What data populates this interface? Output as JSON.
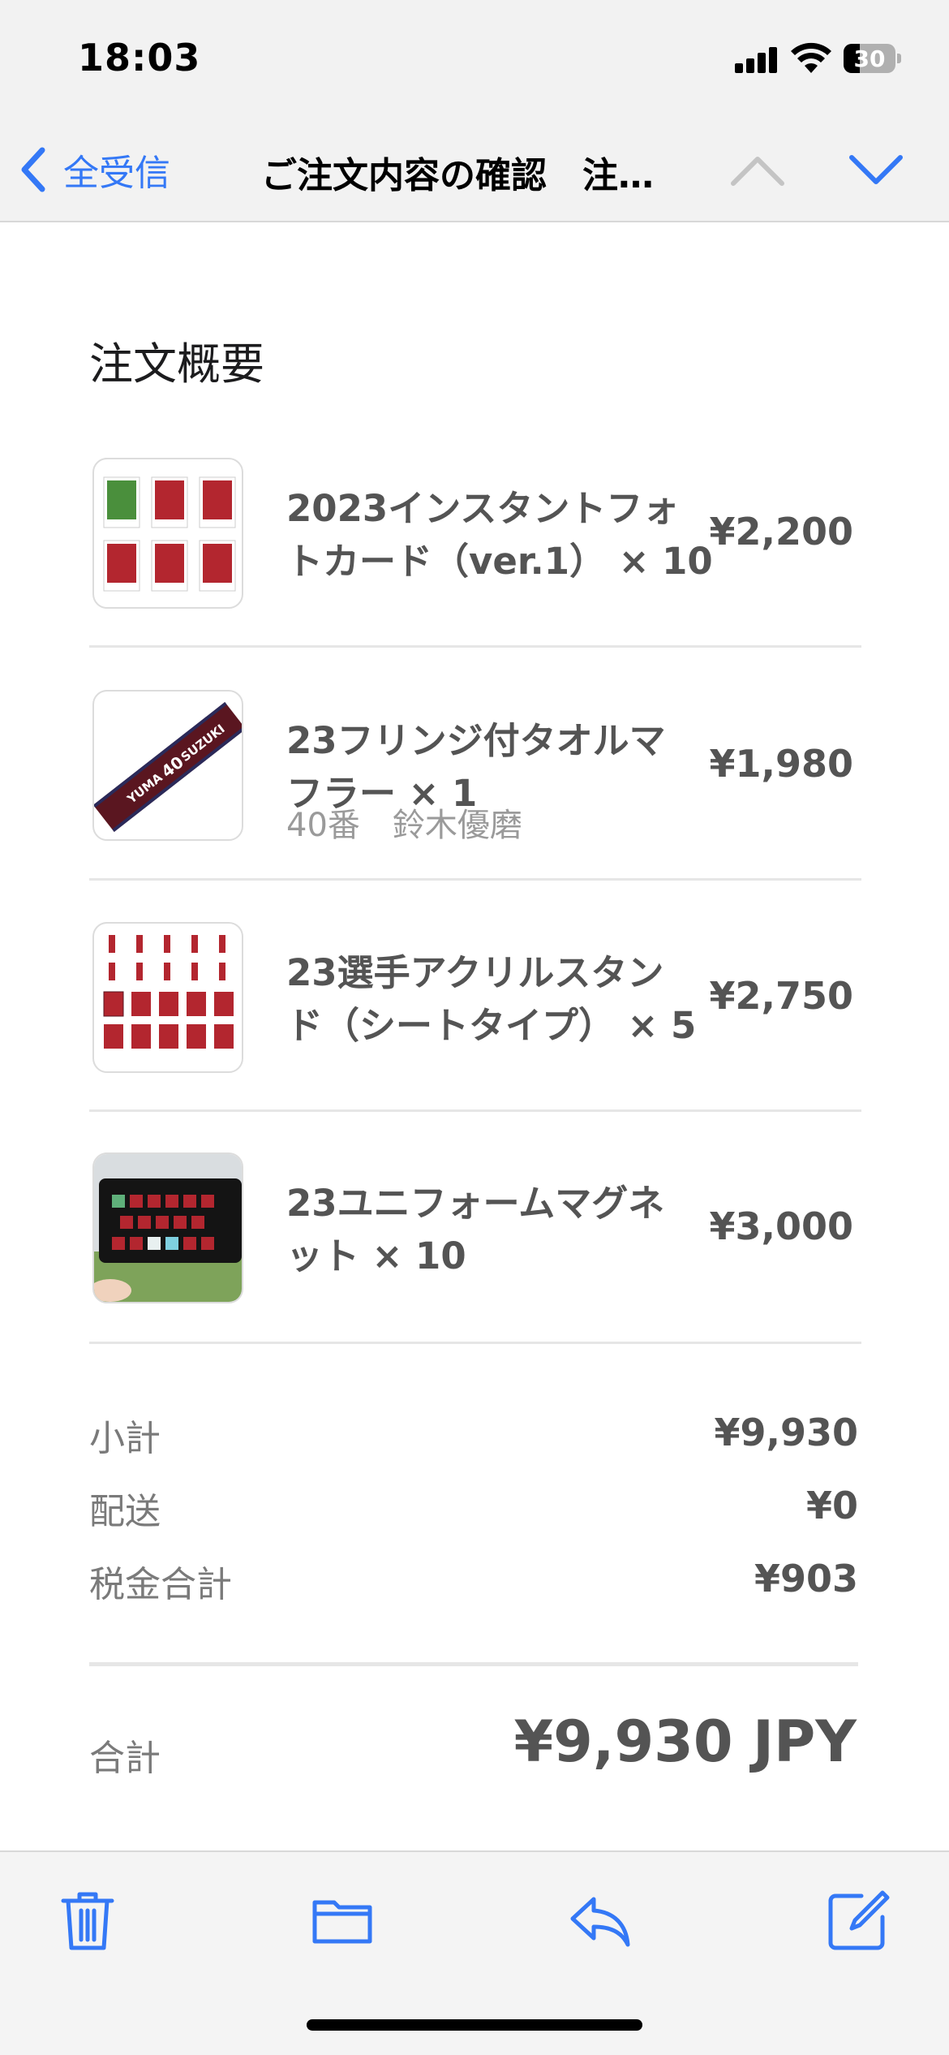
{
  "status_bar": {
    "time": "18:03",
    "battery": "30"
  },
  "nav": {
    "back_label": "全受信",
    "title": "ご注文内容の確認　注…"
  },
  "section_title": "注文概要",
  "items": [
    {
      "name_line1": "2023インスタントフォ",
      "name_line2": "トカード（ver.1） × 10",
      "variant": "",
      "price": "¥2,200"
    },
    {
      "name_line1": "23フリンジ付タオルマ",
      "name_line2": "フラー × 1",
      "variant": "40番　鈴木優磨",
      "price": "¥1,980"
    },
    {
      "name_line1": "23選手アクリルスタン",
      "name_line2": "ド（シートタイプ） × 5",
      "variant": "",
      "price": "¥2,750"
    },
    {
      "name_line1": "23ユニフォームマグネ",
      "name_line2": "ット × 10",
      "variant": "",
      "price": "¥3,000"
    }
  ],
  "thumb_text": {
    "towel_name1": "YUMA",
    "towel_number": "40",
    "towel_name2": "SUZUKI"
  },
  "summary": {
    "subtotal_label": "小計",
    "subtotal_value": "¥9,930",
    "shipping_label": "配送",
    "shipping_value": "¥0",
    "tax_label": "税金合計",
    "tax_value": "¥903",
    "total_label": "合計",
    "total_value": "¥9,930 JPY"
  },
  "colors": {
    "accent": "#3478f6",
    "club_red": "#b3262f",
    "text_gray": "#545454"
  },
  "toolbar_icons": [
    "trash-icon",
    "folder-icon",
    "reply-icon",
    "compose-icon"
  ]
}
